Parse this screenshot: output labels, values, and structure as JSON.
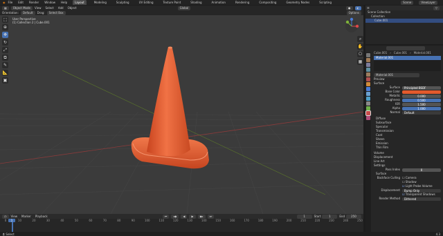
{
  "menu": {
    "items": [
      "File",
      "Edit",
      "Render",
      "Window",
      "Help"
    ]
  },
  "workspaces": [
    "Layout",
    "Modeling",
    "Sculpting",
    "UV Editing",
    "Texture Paint",
    "Shading",
    "Animation",
    "Rendering",
    "Compositing",
    "Geometry Nodes",
    "Scripting"
  ],
  "scene": {
    "scene_label": "Scene",
    "view_layer_label": "ViewLayer"
  },
  "viewport": {
    "mode": "Object Mode",
    "menus": [
      "View",
      "Select",
      "Add",
      "Object"
    ],
    "orientation_label": "Orientation:",
    "orientation": "Default",
    "drag_label": "Drag:",
    "drag": "Select Box",
    "transform": "Global",
    "options": "Options",
    "info_line1": "User Perspective",
    "info_line2": "(1) Collection 2 | Cube.001",
    "axes": {
      "x": "X",
      "y": "Y",
      "z": "Z"
    },
    "colors": {
      "cone": "#e35a2d",
      "grid": "#444444",
      "floor": "#3b3b3b"
    }
  },
  "outliner": {
    "title": "Scene Collection",
    "items": [
      "Collection",
      "Cube.001"
    ]
  },
  "properties": {
    "breadcrumb": [
      "Cube.001",
      "Cube.001",
      "Material.001"
    ],
    "material_slot": "Material.001",
    "material_name": "Material.001",
    "preview": "Preview",
    "surface_section": "Surface",
    "surface_label": "Surface",
    "surface_value": "Principled BSDF",
    "fields": [
      {
        "label": "Base Color",
        "value": "",
        "color": "#e35a2d"
      },
      {
        "label": "Metallic",
        "value": "0.000"
      },
      {
        "label": "Roughness",
        "value": "0.500"
      },
      {
        "label": "IOR",
        "value": "1.500"
      },
      {
        "label": "Alpha",
        "value": "1.000"
      },
      {
        "label": "Normal",
        "value": "Default"
      }
    ],
    "subsections": [
      "Diffuse",
      "Subsurface",
      "Specular",
      "Transmission",
      "Coat",
      "Sheen",
      "Emission",
      "Thin Film"
    ],
    "sections": [
      "Volume",
      "Displacement",
      "Line Art",
      "Settings"
    ],
    "pass_index_label": "Pass Index",
    "pass_index": "0",
    "surface_sub": "Surface",
    "backface_label": "Backface Culling",
    "backface_options": [
      "Camera",
      "Shadow",
      "Light Probe Volume"
    ],
    "displacement_label": "Displacement",
    "displacement_value": "Bump Only",
    "transparent_shadows": "Transparent Shadows",
    "render_method_label": "Render Method",
    "render_method": "Dithered"
  },
  "timeline": {
    "menus": [
      "View",
      "Marker",
      "Playback"
    ],
    "frames": [
      "0",
      "10",
      "20",
      "30",
      "40",
      "50",
      "60",
      "70",
      "80",
      "90",
      "100",
      "110",
      "120",
      "130",
      "140",
      "150",
      "160",
      "170",
      "180",
      "190",
      "200",
      "210",
      "220",
      "230",
      "240",
      "250"
    ],
    "current_frame": "1",
    "start": "1",
    "end": "250",
    "start_label": "Start",
    "end_label": "End"
  },
  "status": {
    "left": "Select",
    "right": "4.3"
  }
}
